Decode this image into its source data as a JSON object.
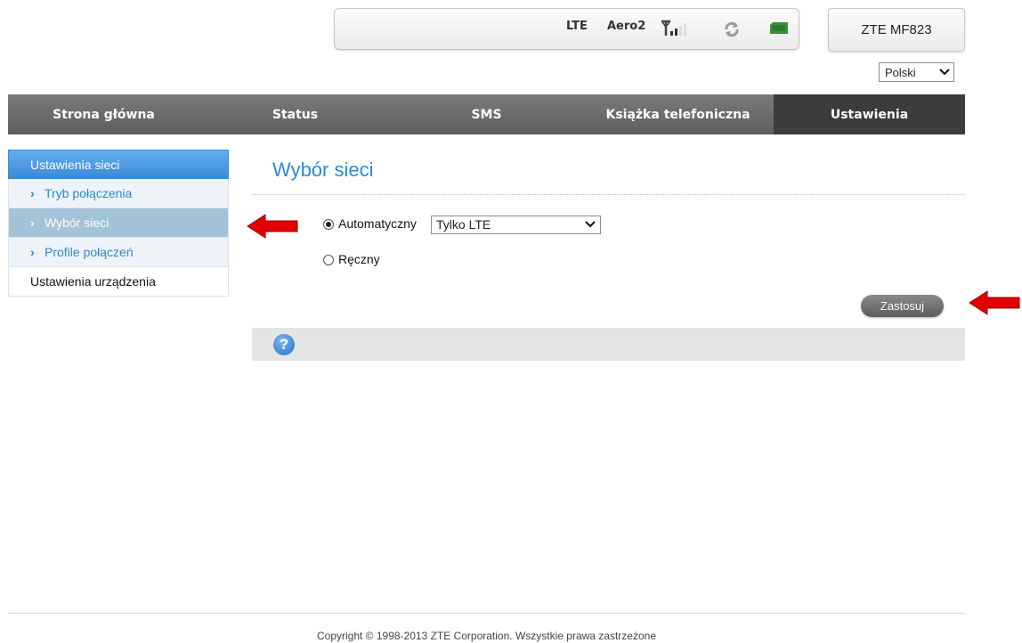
{
  "status": {
    "network_type": "LTE",
    "operator": "Aero2"
  },
  "device": {
    "model": "ZTE MF823"
  },
  "language": {
    "selected": "Polski"
  },
  "nav": {
    "items": [
      {
        "label": "Strona główna"
      },
      {
        "label": "Status"
      },
      {
        "label": "SMS"
      },
      {
        "label": "Książka telefoniczna"
      },
      {
        "label": "Ustawienia"
      }
    ],
    "active_index": 4
  },
  "sidebar": {
    "header": "Ustawienia sieci",
    "items": [
      {
        "label": "Tryb połączenia"
      },
      {
        "label": "Wybór sieci"
      },
      {
        "label": "Profile połączeń"
      }
    ],
    "selected_index": 1,
    "footer_item": "Ustawienia urządzenia"
  },
  "main": {
    "title": "Wybór sieci",
    "auto_label": "Automatyczny",
    "manual_label": "Ręczny",
    "auto_checked": true,
    "mode_select_value": "Tylko LTE",
    "apply_label": "Zastosuj",
    "help_glyph": "?"
  },
  "footer": {
    "copyright": "Copyright © 1998-2013 ZTE Corporation. Wszystkie prawa zastrzeżone"
  },
  "colors": {
    "accent_blue": "#2b8ad6",
    "nav_bg": "#6b6b6b",
    "nav_active": "#3c3c3c",
    "annotation_arrow": "#e00000"
  }
}
